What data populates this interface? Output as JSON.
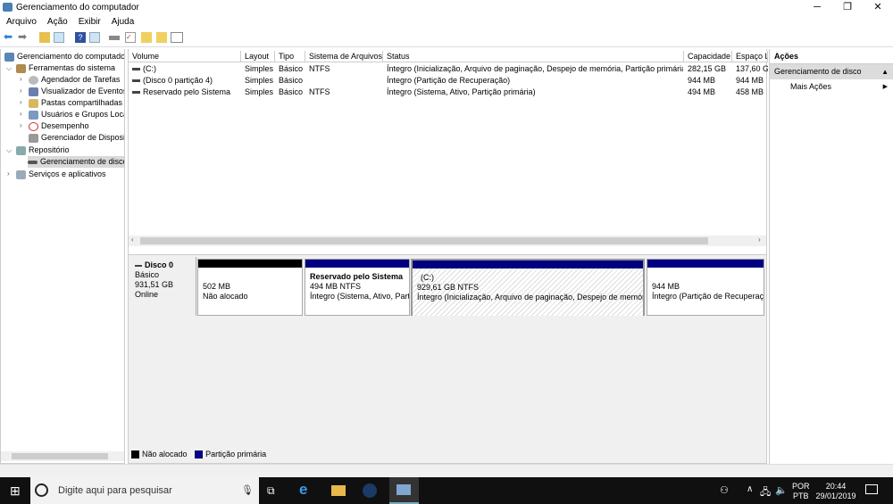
{
  "window": {
    "title": "Gerenciamento do computador",
    "min": "─",
    "max": "❐",
    "close": "✕"
  },
  "menu": [
    "Arquivo",
    "Ação",
    "Exibir",
    "Ajuda"
  ],
  "tree": {
    "root": "Gerenciamento do computado",
    "system_tools": "Ferramentas do sistema",
    "items": [
      "Agendador de Tarefas",
      "Visualizador de Eventos",
      "Pastas compartilhadas",
      "Usuários e Grupos Loca",
      "Desempenho",
      "Gerenciador de Disposit"
    ],
    "storage": "Repositório",
    "disk_mgmt": "Gerenciamento de disco",
    "services": "Serviços e aplicativos"
  },
  "table": {
    "columns": [
      "Volume",
      "Layout",
      "Tipo",
      "Sistema de Arquivos",
      "Status",
      "Capacidade",
      "Espaço L"
    ],
    "rows": [
      [
        "(C:)",
        "Simples",
        "Básico",
        "NTFS",
        "Íntegro (Inicialização, Arquivo de paginação, Despejo de memória, Partição primária)",
        "282,15 GB",
        "137,60 G"
      ],
      [
        "(Disco 0 partição 4)",
        "Simples",
        "Básico",
        "",
        "Íntegro (Partição de Recuperação)",
        "944 MB",
        "944 MB"
      ],
      [
        "Reservado pelo Sistema",
        "Simples",
        "Básico",
        "NTFS",
        "Íntegro (Sistema, Ativo, Partição primária)",
        "494 MB",
        "458 MB"
      ]
    ]
  },
  "disk": {
    "name": "Disco 0",
    "type": "Básico",
    "size": "931,51 GB",
    "state": "Online",
    "partitions": [
      {
        "title": "",
        "size": "502 MB",
        "status": "Não alocado",
        "color": "#000000"
      },
      {
        "title": "Reservado pelo Sistema",
        "size": "494 MB NTFS",
        "status": "Íntegro (Sistema, Ativo, Part",
        "color": "#000080"
      },
      {
        "title": "(C:)",
        "size": "929,61 GB NTFS",
        "status": "Íntegro (Inicialização, Arquivo de paginação, Despejo de memória",
        "color": "#000080"
      },
      {
        "title": "",
        "size": "944 MB",
        "status": "Íntegro (Partição de Recuperaçã",
        "color": "#000080"
      }
    ]
  },
  "legend": [
    {
      "label": "Não alocado",
      "color": "#000000"
    },
    {
      "label": "Partição primária",
      "color": "#000080"
    }
  ],
  "actions": {
    "title": "Ações",
    "section": "Gerenciamento de disco",
    "more": "Mais Ações"
  },
  "taskbar": {
    "search_placeholder": "Digite aqui para pesquisar",
    "lang1": "POR",
    "lang2": "PTB",
    "time": "20:44",
    "date": "29/01/2019"
  }
}
